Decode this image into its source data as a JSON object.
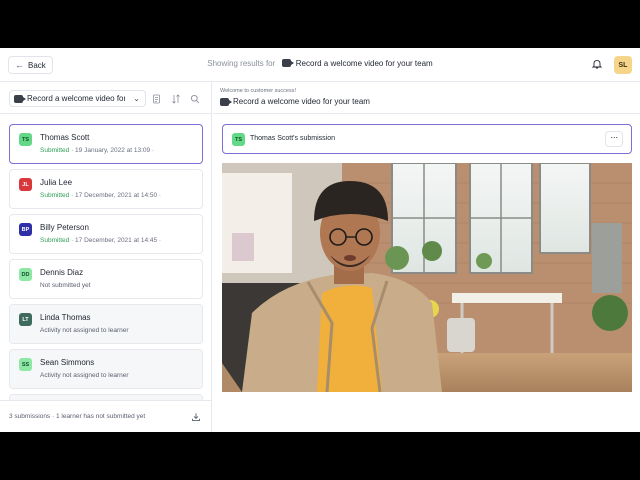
{
  "header": {
    "back_label": "Back",
    "showing_prefix": "Showing results for",
    "activity_title": "Record a welcome video for your team",
    "user_initials": "SL"
  },
  "sidebar": {
    "activity_select_value": "Record a welcome video for your team",
    "submissions": [
      {
        "initials": "TS",
        "name": "Thomas Scott",
        "status": "Submitted",
        "date": " · 19 January, 2022 at 13:09 ·",
        "badge_bg": "#63d886",
        "badge_fg": "#134d26"
      },
      {
        "initials": "JL",
        "name": "Julia Lee",
        "status": "Submitted",
        "date": " · 17 December, 2021 at 14:50 ·",
        "badge_bg": "#d8383c",
        "badge_fg": "#ffffff"
      },
      {
        "initials": "BP",
        "name": "Billy Peterson",
        "status": "Submitted",
        "date": " · 17 December, 2021 at 14:45 ·",
        "badge_bg": "#2f2fa8",
        "badge_fg": "#ffffff"
      },
      {
        "initials": "DD",
        "name": "Dennis Diaz",
        "status": "Not submitted yet",
        "date": "",
        "badge_bg": "#8ee8a5",
        "badge_fg": "#134d26"
      },
      {
        "initials": "LT",
        "name": "Linda Thomas",
        "status": "Activity not assigned to learner",
        "date": "",
        "badge_bg": "#3e6b5d",
        "badge_fg": "#ffffff"
      },
      {
        "initials": "SS",
        "name": "Sean Simmons",
        "status": "Activity not assigned to learner",
        "date": "",
        "badge_bg": "#8ee8a5",
        "badge_fg": "#134d26"
      }
    ],
    "footer_text": "3 submissions · 1 learner has not submitted yet"
  },
  "main": {
    "kicker": "Welcome to customer success!",
    "title": "Record a welcome video for your team",
    "submission_initials": "TS",
    "submission_title": "Thomas Scott's submission",
    "more_label": "···"
  },
  "colors": {
    "accent": "#7b6fd6",
    "success": "#2f9e57"
  }
}
